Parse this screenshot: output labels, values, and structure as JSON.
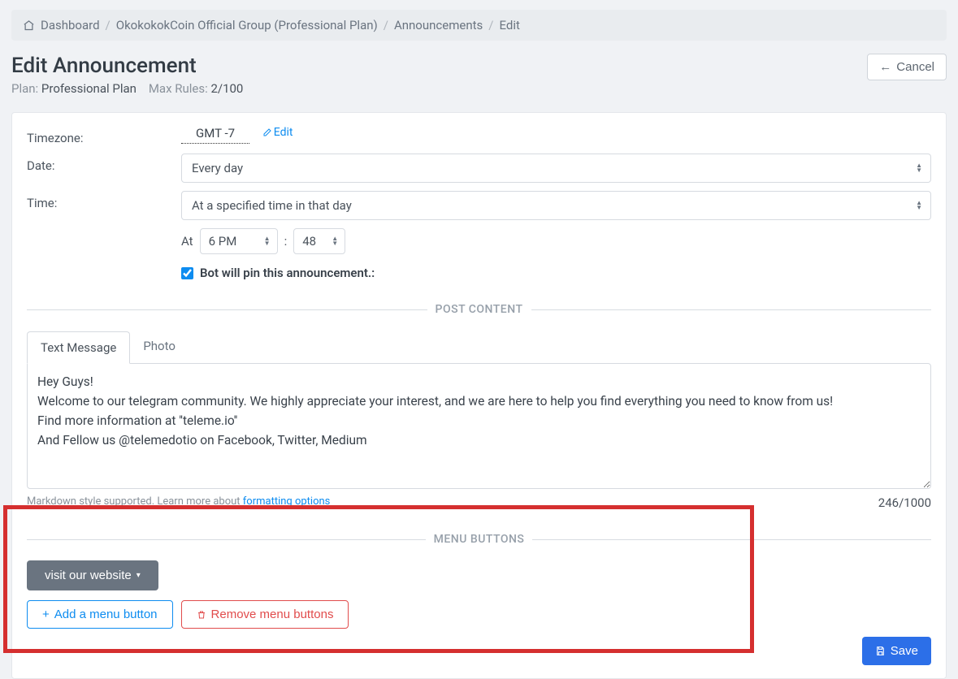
{
  "breadcrumb": {
    "dashboard": "Dashboard",
    "group": "OkokokokCoin Official Group (Professional Plan)",
    "announcements": "Announcements",
    "current": "Edit"
  },
  "header": {
    "title": "Edit Announcement",
    "plan_label": "Plan: ",
    "plan_value": "Professional Plan",
    "maxrules_label": "Max Rules: ",
    "maxrules_value": "2/100",
    "cancel": "Cancel"
  },
  "form": {
    "timezone_label": "Timezone:",
    "timezone_value": "GMT -7",
    "edit": "Edit",
    "date_label": "Date:",
    "date_value": "Every day",
    "time_label": "Time:",
    "time_value": "At a specified time in that day",
    "at_label": "At",
    "hour": "6 PM",
    "colon": ":",
    "minute": "48",
    "pin_label": "Bot will pin this announcement.:"
  },
  "post": {
    "section": "POST CONTENT",
    "tab_text": "Text Message",
    "tab_photo": "Photo",
    "content": "Hey Guys!\nWelcome to our telegram community. We highly appreciate your interest, and we are here to help you find everything you need to know from us!\nFind more information at ''teleme.io''\nAnd Fellow us @telemedotio on Facebook, Twitter, Medium",
    "hint_prefix": "Markdown style supported. Learn more about ",
    "hint_link": "formatting options",
    "counter": "246/1000"
  },
  "menu": {
    "section": "MENU BUTTONS",
    "visit": "visit our website",
    "add": "Add a menu button",
    "remove": "Remove menu buttons"
  },
  "footer": {
    "save": "Save"
  }
}
